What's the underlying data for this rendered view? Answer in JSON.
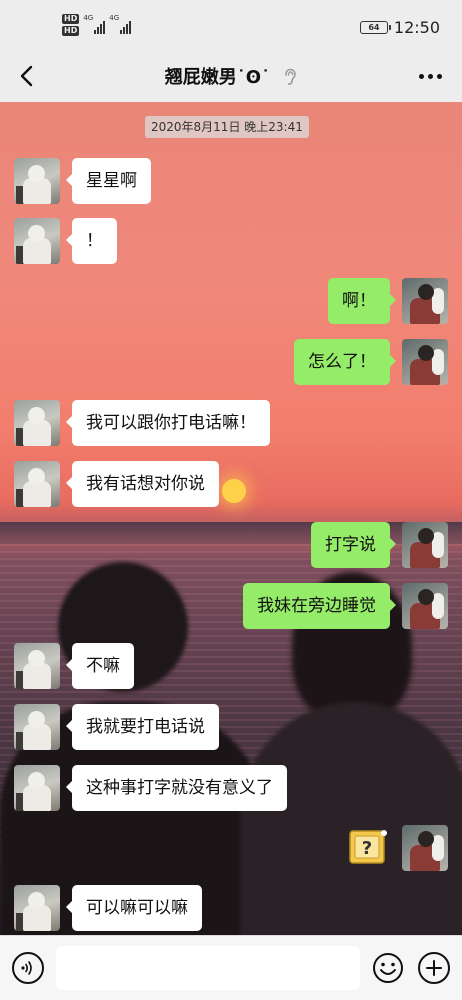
{
  "status_bar": {
    "hd_1": "HD",
    "hd_2": "HD",
    "net_1": "4G",
    "net_2": "4G",
    "battery_level": "64",
    "time": "12:50"
  },
  "header": {
    "title": "翘屁嫩男˙ʘ˙",
    "back_icon": "chevron-left-icon",
    "mute_icon": "ear-mute-icon",
    "more_icon": "more-dots-icon"
  },
  "chat": {
    "timestamp": "2020年8月11日 晚上23:41",
    "messages": [
      {
        "side": "left",
        "text": "星星啊"
      },
      {
        "side": "left",
        "text": "！"
      },
      {
        "side": "right",
        "text": "啊！"
      },
      {
        "side": "right",
        "text": "怎么了！"
      },
      {
        "side": "left",
        "text": "我可以跟你打电话嘛！"
      },
      {
        "side": "left",
        "text": "我有话想对你说"
      },
      {
        "side": "right",
        "text": "打字说"
      },
      {
        "side": "right",
        "text": "我妹在旁边睡觉"
      },
      {
        "side": "left",
        "text": "不嘛"
      },
      {
        "side": "left",
        "text": "我就要打电话说"
      },
      {
        "side": "left",
        "text": "这种事打字就没有意义了"
      },
      {
        "side": "right",
        "sticker": "question-mark-sticker"
      },
      {
        "side": "left",
        "text": "可以嘛可以嘛"
      }
    ]
  },
  "input_bar": {
    "voice_icon": "voice-icon",
    "input_placeholder": "",
    "emoji_icon": "emoji-icon",
    "plus_icon": "plus-icon"
  },
  "colors": {
    "bubble_mine": "#95ec69",
    "bubble_theirs": "#ffffff",
    "chrome": "#ededed"
  }
}
